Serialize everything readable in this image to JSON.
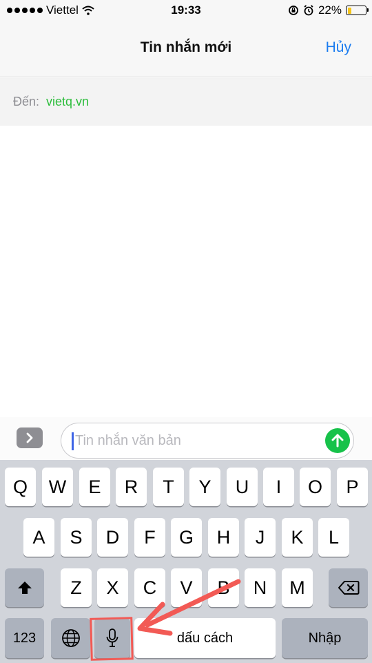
{
  "status_bar": {
    "carrier": "Viettel",
    "time": "19:33",
    "battery_percent": "22%",
    "battery_level": 0.22,
    "battery_color": "#f5c518",
    "icons": [
      "signal-dots-icon",
      "wifi-icon",
      "lock-rotation-icon",
      "alarm-icon",
      "battery-icon"
    ]
  },
  "nav": {
    "title": "Tin nhắn mới",
    "cancel_label": "Hủy",
    "accent_color": "#1a7cf0"
  },
  "recipient": {
    "label": "Đến:",
    "value": "vietq.vn",
    "value_color": "#2dbd3c"
  },
  "composer": {
    "placeholder": "Tin nhắn văn bản",
    "expand_icon": "chevron-right-icon",
    "send_icon": "arrow-up-icon",
    "send_color": "#17c24a"
  },
  "keyboard": {
    "row1": [
      "Q",
      "W",
      "E",
      "R",
      "T",
      "Y",
      "U",
      "I",
      "O",
      "P"
    ],
    "row2": [
      "A",
      "S",
      "D",
      "F",
      "G",
      "H",
      "J",
      "K",
      "L"
    ],
    "row3": [
      "Z",
      "X",
      "C",
      "V",
      "B",
      "N",
      "M"
    ],
    "numbers_label": "123",
    "space_label": "dấu cách",
    "return_label": "Nhập",
    "icons": [
      "shift-icon",
      "backspace-icon",
      "globe-icon",
      "microphone-icon"
    ]
  },
  "annotation": {
    "color": "#f25a55",
    "target": "microphone-key"
  }
}
